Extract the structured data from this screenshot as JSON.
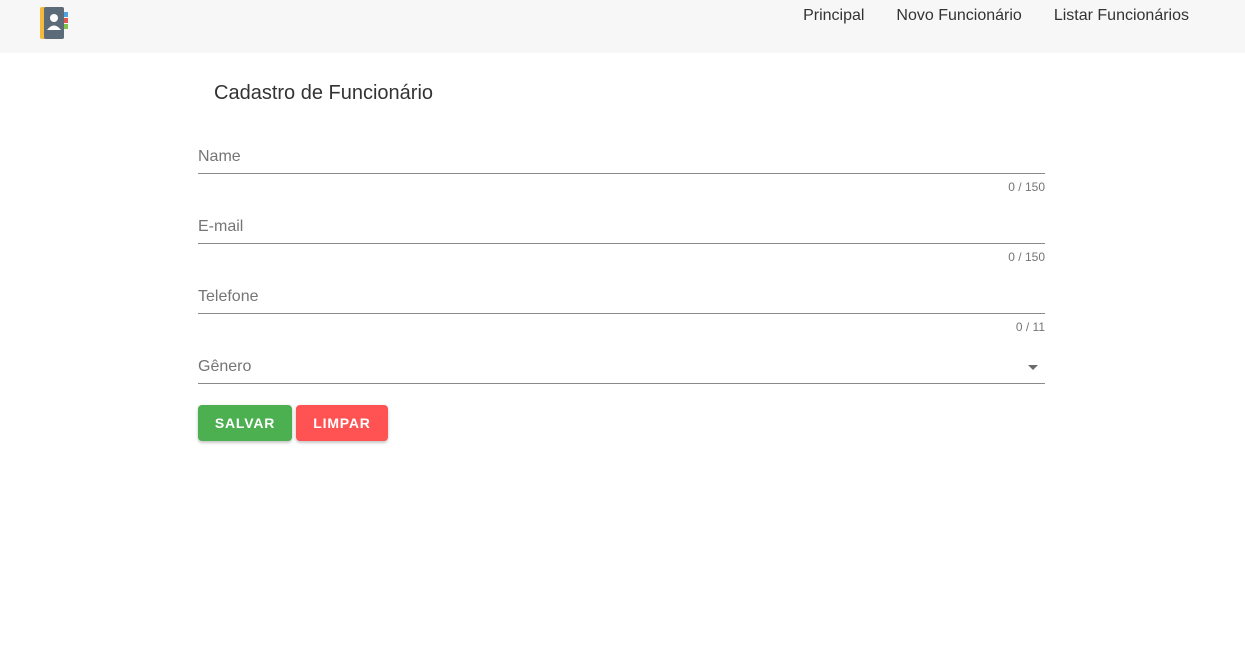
{
  "header": {
    "logo_icon": "address-book-icon",
    "nav": [
      {
        "label": "Principal"
      },
      {
        "label": "Novo Funcionário"
      },
      {
        "label": "Listar Funcionários"
      }
    ]
  },
  "form": {
    "title": "Cadastro de Funcionário",
    "fields": {
      "name": {
        "placeholder": "Name",
        "value": "",
        "counter": "0 / 150"
      },
      "email": {
        "placeholder": "E-mail",
        "value": "",
        "counter": "0 / 150"
      },
      "phone": {
        "placeholder": "Telefone",
        "value": "",
        "counter": "0 / 11"
      },
      "gender": {
        "placeholder": "Gênero",
        "arrow_icon": "dropdown-arrow-icon"
      }
    },
    "buttons": {
      "save": "SALVAR",
      "clear": "LIMPAR"
    }
  },
  "colors": {
    "header_bg": "#f7f7f7",
    "save_button": "#4caf50",
    "clear_button": "#ff5252"
  }
}
